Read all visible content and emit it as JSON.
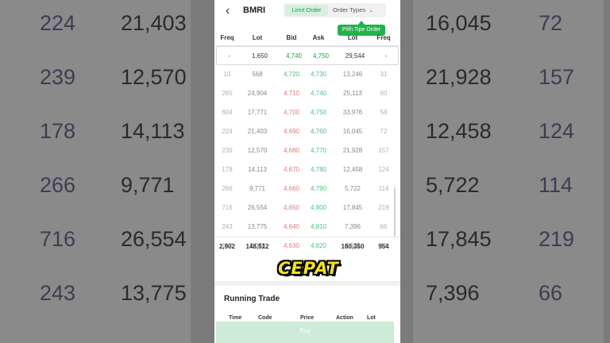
{
  "colors": {
    "accent_green": "#22b24c",
    "bid_red": "#e07a7a",
    "ask_green": "#4cc17a"
  },
  "header": {
    "back_icon": "chevron-left-icon",
    "ticker": "BMRI",
    "limit_order": "Limit Order",
    "order_types": "Order Types",
    "tooltip": "Pilih Tipe Order"
  },
  "columns": {
    "freq": "Freq",
    "lot": "Lot",
    "bid": "Bid",
    "ask": "Ask",
    "lot2": "Lot",
    "freq2": "Freq"
  },
  "rows": [
    {
      "freq": "-",
      "lot": "1,650",
      "bid": "4,740",
      "ask": "4,750",
      "lot2": "29,544",
      "freq2": "-"
    },
    {
      "freq": "10",
      "lot": "568",
      "bid": "4,720",
      "ask": "4,730",
      "lot2": "13,246",
      "freq2": "31"
    },
    {
      "freq": "265",
      "lot": "24,904",
      "bid": "4,710",
      "ask": "4,740",
      "lot2": "25,113",
      "freq2": "60"
    },
    {
      "freq": "604",
      "lot": "17,771",
      "bid": "4,700",
      "ask": "4,750",
      "lot2": "33,976",
      "freq2": "58"
    },
    {
      "freq": "224",
      "lot": "21,403",
      "bid": "4,690",
      "ask": "4,760",
      "lot2": "16,045",
      "freq2": "72"
    },
    {
      "freq": "239",
      "lot": "12,570",
      "bid": "4,680",
      "ask": "4,770",
      "lot2": "21,928",
      "freq2": "157"
    },
    {
      "freq": "178",
      "lot": "14,113",
      "bid": "4,670",
      "ask": "4,780",
      "lot2": "12,458",
      "freq2": "124"
    },
    {
      "freq": "266",
      "lot": "9,771",
      "bid": "4,660",
      "ask": "4,790",
      "lot2": "5,722",
      "freq2": "114"
    },
    {
      "freq": "716",
      "lot": "26,554",
      "bid": "4,650",
      "ask": "4,800",
      "lot2": "17,845",
      "freq2": "219"
    },
    {
      "freq": "243",
      "lot": "13,775",
      "bid": "4,640",
      "ask": "4,810",
      "lot2": "7,396",
      "freq2": "66"
    },
    {
      "freq": "157",
      "lot": "7,083",
      "bid": "4,630",
      "ask": "4,820",
      "lot2": "6,621",
      "freq2": "53"
    }
  ],
  "totals": {
    "freq": "2,902",
    "lot": "148,512",
    "lot2": "160,350",
    "freq2": "954"
  },
  "overlay": {
    "caption": "CEPAT"
  },
  "running_trade": {
    "title": "Running Trade",
    "cols": {
      "time": "Time",
      "code": "Code",
      "price": "Price",
      "action": "Action",
      "lot": "Lot"
    }
  },
  "buy_button": "Buy",
  "background": {
    "left_col": [
      {
        "a": "224",
        "b": "21,403"
      },
      {
        "a": "239",
        "b": "12,570"
      },
      {
        "a": "178",
        "b": "14,113"
      },
      {
        "a": "266",
        "b": "9,771"
      },
      {
        "a": "716",
        "b": "26,554"
      },
      {
        "a": "243",
        "b": "13,775"
      }
    ],
    "right_col": [
      {
        "a": "16,045",
        "b": "72"
      },
      {
        "a": "21,928",
        "b": "157"
      },
      {
        "a": "12,458",
        "b": "124"
      },
      {
        "a": "5,722",
        "b": "114"
      },
      {
        "a": "17,845",
        "b": "219"
      },
      {
        "a": "7,396",
        "b": "66"
      }
    ]
  }
}
